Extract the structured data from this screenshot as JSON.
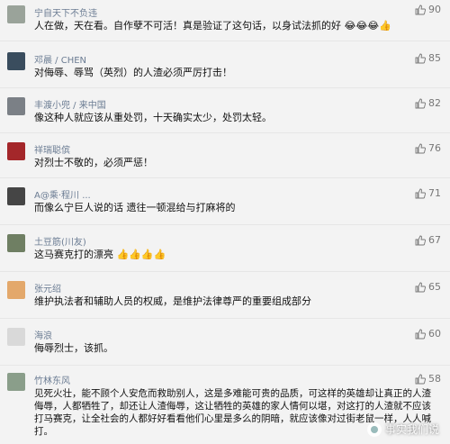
{
  "comments": [
    {
      "name": "宁自天下不负违",
      "likes": "90",
      "text": "人在做，天在看。自作孽不可活！真是验证了这句话，以身试法抓的好",
      "emojis": "😂😂😂👍",
      "avatar_color": "#9aa39a"
    },
    {
      "name": "邓晨 / CHEN",
      "likes": "85",
      "text": "对侮辱、辱骂（英烈）的人渣必须严厉打击！",
      "emojis": "",
      "avatar_color": "#3a4d5e"
    },
    {
      "name": "丰渡小兜 / 来中国",
      "likes": "82",
      "text": "像这种人就应该从重处罚，十天确实太少，处罚太轻。",
      "emojis": "",
      "avatar_color": "#7b8086"
    },
    {
      "name": "祥瑞聪傧",
      "likes": "76",
      "text": "对烈士不敬的，必须严惩！",
      "emojis": "",
      "avatar_color": "#a4272a"
    },
    {
      "name": "A@乘·程川 ...",
      "likes": "71",
      "text": "而像么宁巨人说的话  遗往一顿混给与打麻将的",
      "emojis": "",
      "avatar_color": "#454545"
    },
    {
      "name": "土豆筋(川友)",
      "likes": "67",
      "text": "这马赛克打的漂亮",
      "emojis": "👍👍👍👍",
      "avatar_color": "#6f7f63"
    },
    {
      "name": "张元绍",
      "likes": "65",
      "text": "维护执法者和辅助人员的权威，是维护法律尊严的重要组成部分",
      "emojis": "",
      "avatar_color": "#e3a86b"
    },
    {
      "name": "海浪",
      "likes": "60",
      "text": "侮辱烈士，该抓。",
      "emojis": "",
      "avatar_color": "#d9d9d9"
    },
    {
      "name": "竹林东风",
      "likes": "58",
      "text": "见死火壮，能不顾个人安危而救助别人，这是多难能可贵的品质，可这样的英雄却让真正的人渣侮辱，人都牺牲了，却还让人渣侮辱，这让牺牲的英雄的家人情何以堪，对这打的人渣就不应该打马赛克，让全社会的人都好好看看他们心里是多么的阴暗，就应该像对过街老鼠一样，人人喊打。",
      "emojis": "",
      "avatar_color": "#8a9e8a"
    }
  ],
  "watermark": "事实我们说"
}
